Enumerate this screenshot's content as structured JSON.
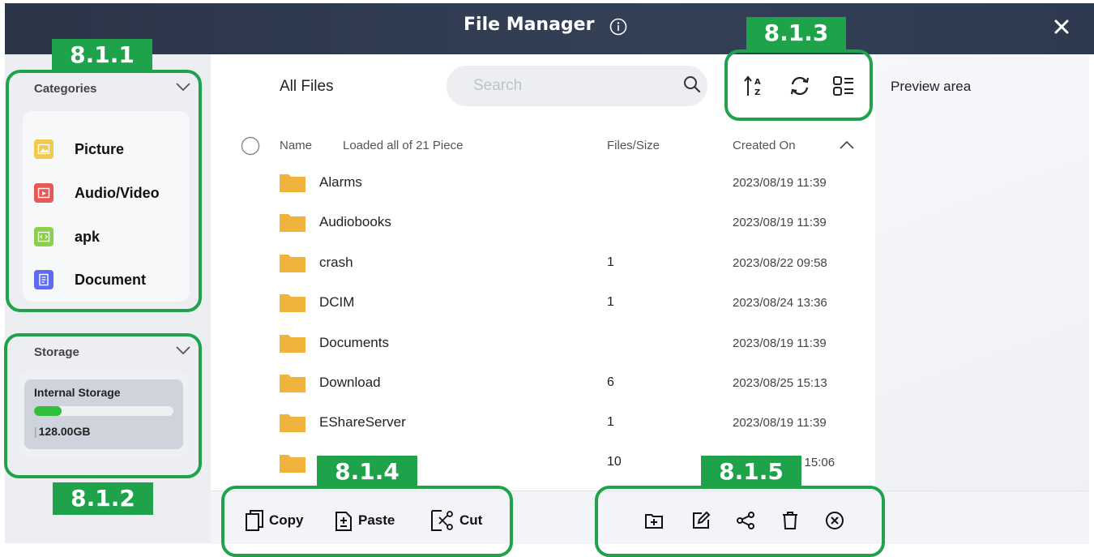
{
  "window": {
    "title": "File Manager"
  },
  "annotations": {
    "categories_box": "8.1.1",
    "storage_box": "8.1.2",
    "toolbar_box": "8.1.3",
    "clipboard_box": "8.1.4",
    "actions_box": "8.1.5"
  },
  "sidebar": {
    "categories_title": "Categories",
    "categories": [
      {
        "label": "Picture",
        "icon": "picture-icon",
        "color": "#f2c94c"
      },
      {
        "label": "Audio/Video",
        "icon": "video-icon",
        "color": "#eb5757"
      },
      {
        "label": "apk",
        "icon": "apk-icon",
        "color": "#8ccf4d"
      },
      {
        "label": "Document",
        "icon": "document-icon",
        "color": "#5b6cf0"
      }
    ],
    "storage_title": "Storage",
    "storage": {
      "name": "Internal Storage",
      "capacity": "128.00GB",
      "used_fraction": 0.2,
      "bar_color": "#2fbf3a"
    }
  },
  "main": {
    "heading": "All Files",
    "search_placeholder": "Search",
    "columns": {
      "name": "Name",
      "loaded": "Loaded all of 21 Piece",
      "size": "Files/Size",
      "created": "Created On"
    },
    "files": [
      {
        "name": "Alarms",
        "size": "",
        "created": "2023/08/19 11:39"
      },
      {
        "name": "Audiobooks",
        "size": "",
        "created": "2023/08/19 11:39"
      },
      {
        "name": "crash",
        "size": "1",
        "created": "2023/08/22 09:58"
      },
      {
        "name": "DCIM",
        "size": "1",
        "created": "2023/08/24 13:36"
      },
      {
        "name": "Documents",
        "size": "",
        "created": "2023/08/19 11:39"
      },
      {
        "name": "Download",
        "size": "6",
        "created": "2023/08/25 15:13"
      },
      {
        "name": "EShareServer",
        "size": "1",
        "created": "2023/08/19 11:39"
      },
      {
        "name": "",
        "size": "10",
        "created": "2 15:06"
      }
    ]
  },
  "preview": {
    "label": "Preview area"
  },
  "bottombar": {
    "copy": "Copy",
    "paste": "Paste",
    "cut": "Cut"
  },
  "colors": {
    "accent_green": "#1ea34b",
    "folder": "#f0b43c",
    "titlebar": "#2f3a4f"
  }
}
